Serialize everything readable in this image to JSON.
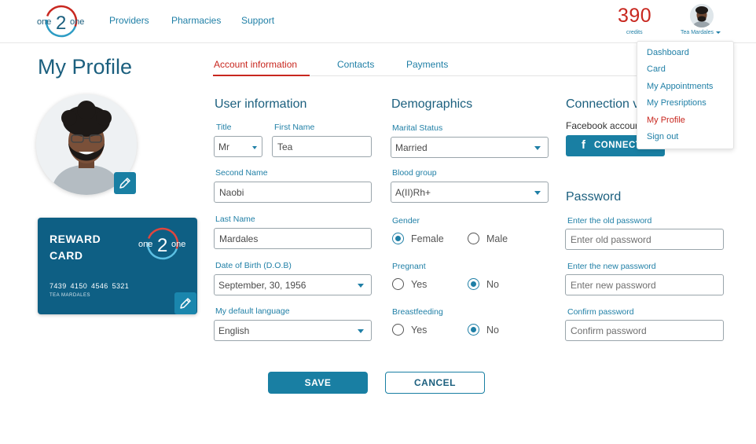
{
  "header": {
    "logo": {
      "left": "one",
      "mid": "2",
      "right": "one"
    },
    "nav": [
      "Providers",
      "Pharmacies",
      "Support"
    ],
    "credits": {
      "value": "390",
      "label": "credits"
    },
    "user_name": "Tea Mardales"
  },
  "menu": {
    "items": [
      "Dashboard",
      "Card",
      "My Appointments",
      "My Presriptions",
      "My Profile",
      "Sign out"
    ],
    "active": "My Profile"
  },
  "page_title": "My Profile",
  "tabs": [
    "Account information",
    "Contacts",
    "Payments"
  ],
  "active_tab": "Account information",
  "reward_card": {
    "title": "REWARD CARD",
    "number": "7439 4150 4546 5321",
    "holder": "TEA MARDALES"
  },
  "user_info": {
    "title": "User information",
    "title_label": "Title",
    "title_value": "Mr",
    "first_name_label": "First Name",
    "first_name": "Tea",
    "second_name_label": "Second Name",
    "second_name": "Naobi",
    "last_name_label": "Last Name",
    "last_name": "Mardales",
    "dob_label": "Date of Birth (D.O.B)",
    "dob": "September, 30, 1956",
    "language_label": "My default language",
    "language": "English"
  },
  "demographics": {
    "title": "Demographics",
    "marital_label": "Marital Status",
    "marital": "Married",
    "blood_label": "Blood group",
    "blood": "A(II)Rh+",
    "gender_label": "Gender",
    "gender_options": [
      "Female",
      "Male"
    ],
    "gender": "Female",
    "pregnant_label": "Pregnant",
    "pregnant_options": [
      "Yes",
      "No"
    ],
    "pregnant": "No",
    "breastfeeding_label": "Breastfeeding",
    "breastfeeding_options": [
      "Yes",
      "No"
    ],
    "breastfeeding": "No"
  },
  "connection": {
    "title": "Connection via",
    "facebook_text": "Facebook account",
    "connect_label": "CONNECT"
  },
  "password": {
    "title": "Password",
    "old_label": "Enter the old password",
    "old_placeholder": "Enter old password",
    "new_label": "Enter the new password",
    "new_placeholder": "Enter new password",
    "confirm_label": "Confirm password",
    "confirm_placeholder": "Confirm password"
  },
  "actions": {
    "save": "SAVE",
    "cancel": "CANCEL"
  },
  "colors": {
    "accent": "#197fa3",
    "brand_dark": "#0e5f84",
    "highlight": "#c8271f",
    "link": "#1f7fa6"
  },
  "icons": {
    "edit_photo": "pencil-icon",
    "edit_card": "pencil-icon",
    "facebook": "facebook-icon",
    "dropdown": "chevron-down-icon"
  }
}
